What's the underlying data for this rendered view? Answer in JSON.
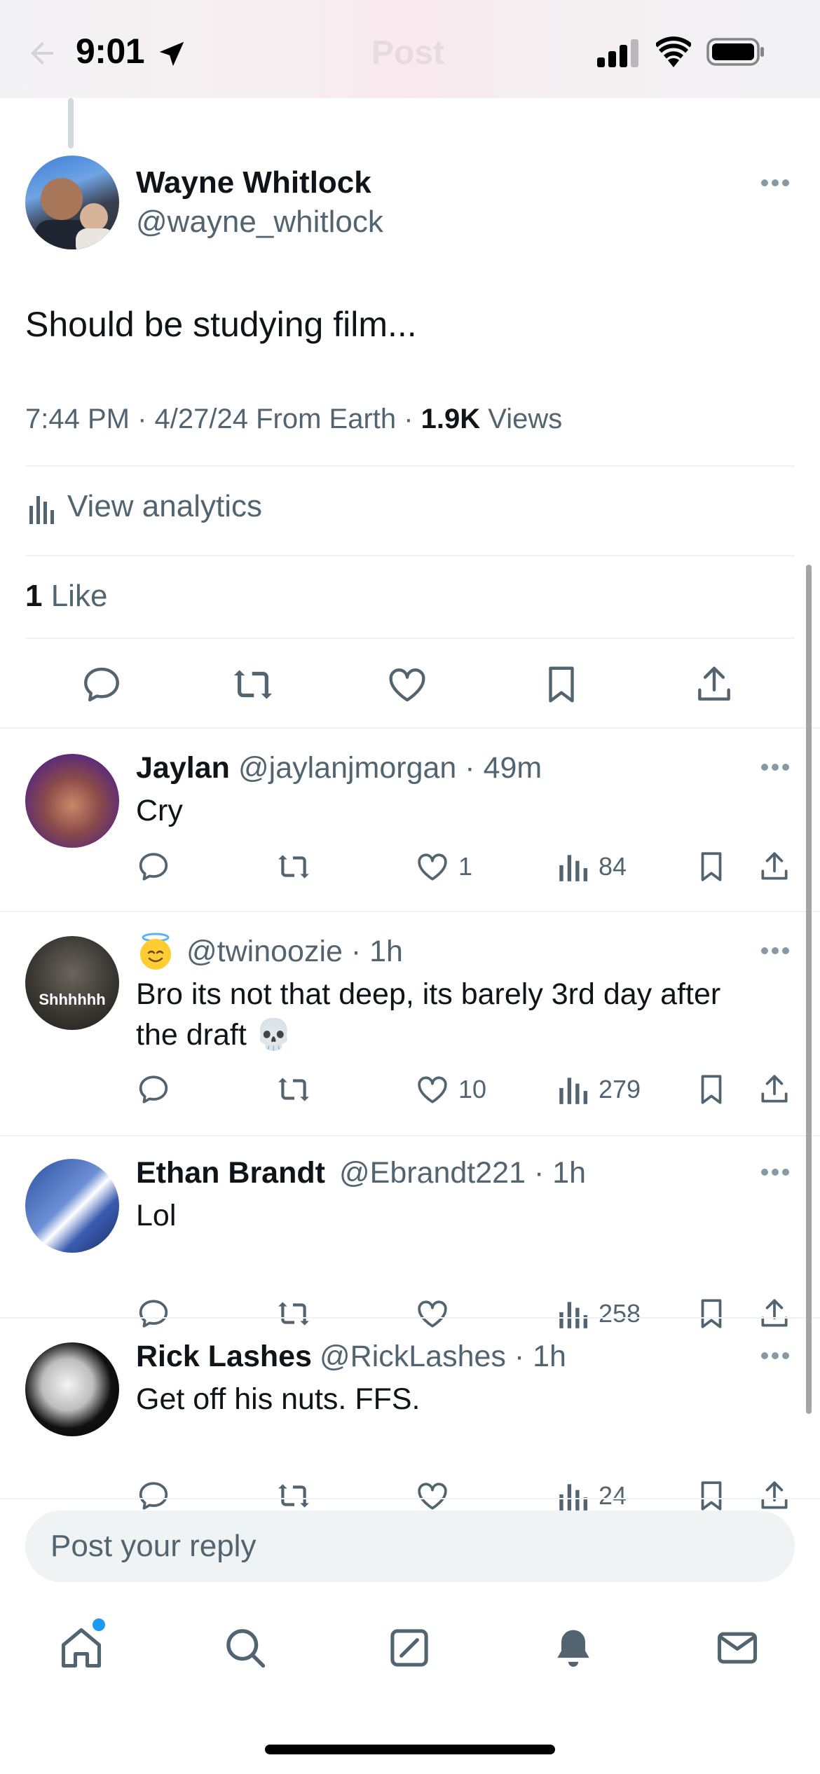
{
  "status_bar": {
    "time": "9:01"
  },
  "header": {
    "title": "Post"
  },
  "post": {
    "author_name": "Wayne Whitlock",
    "author_handle": "@wayne_whitlock",
    "text": "Should be studying film...",
    "timestamp": "7:44 PM · 4/27/24 From Earth · ",
    "views_count": "1.9K",
    "views_label": " Views",
    "analytics_label": "View analytics",
    "likes_count": "1",
    "likes_label": " Like"
  },
  "replies": [
    {
      "name": "Jaylan",
      "handle": "@jaylanjmorgan · 49m",
      "text": "Cry",
      "likes": "1",
      "views": "84"
    },
    {
      "name": "",
      "handle": "@twinoozie · 1h",
      "text": "Bro its not that deep, its barely 3rd day after the draft 💀",
      "likes": "10",
      "views": "279",
      "avatar_caption": "Shhhhhh"
    },
    {
      "name": "Ethan Brandt",
      "handle": "@Ebrandt221 · 1h",
      "text": "Lol",
      "likes": "",
      "views": "258"
    },
    {
      "name": "Rick Lashes",
      "handle": "@RickLashes · 1h",
      "text": "Get off his nuts. FFS.",
      "likes": "",
      "views": "24"
    }
  ],
  "reply_input": {
    "placeholder": "Post your reply"
  },
  "tab_bar": {
    "items": [
      "home-icon",
      "search-icon",
      "compose-icon",
      "bell-icon",
      "mail-icon"
    ]
  },
  "colors": {
    "accent": "#1d9bf0",
    "text": "#0f1419",
    "secondary": "#536471",
    "divider": "#eff3f4"
  }
}
